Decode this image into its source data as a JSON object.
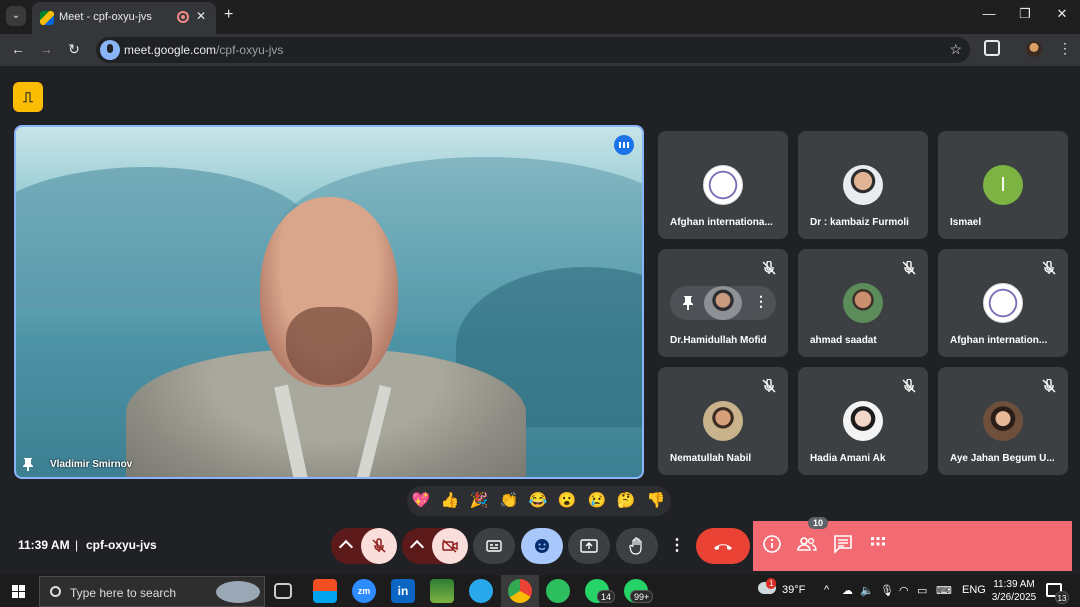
{
  "browser": {
    "tab_title": "Meet - cpf-oxyu-jvs",
    "new_tab_label": "+",
    "url_host": "meet.google.com",
    "url_path": "/cpf-oxyu-jvs",
    "window_controls": [
      "—",
      "❐",
      "✕"
    ]
  },
  "meet": {
    "main_speaker_name": "Vladimir Smirnov",
    "participants": [
      {
        "name": "Afghan internationa...",
        "avatar": "seal-logo",
        "muted": false
      },
      {
        "name": "Dr : kambaiz Furmoli",
        "avatar": "photo",
        "muted": false
      },
      {
        "name": "Ismael",
        "avatar": "letter",
        "letter": "I",
        "muted": false
      },
      {
        "name": "Dr.Hamidullah Mofid",
        "avatar": "photo",
        "muted": true
      },
      {
        "name": "ahmad saadat",
        "avatar": "photo",
        "muted": true
      },
      {
        "name": "Afghan internation...",
        "avatar": "seal-logo",
        "muted": true
      },
      {
        "name": "Nematullah Nabil",
        "avatar": "photo",
        "muted": true
      },
      {
        "name": "Hadia Amani Ak",
        "avatar": "photo",
        "muted": true
      },
      {
        "name": "Aye Jahan Begum U...",
        "avatar": "photo",
        "muted": true
      }
    ],
    "reactions": [
      "💖",
      "👍",
      "🎉",
      "👏",
      "😂",
      "😮",
      "😢",
      "🤔",
      "👎"
    ],
    "time": "11:39 AM",
    "separator": "|",
    "meeting_code": "cpf-oxyu-jvs",
    "people_count": "10",
    "colors": {
      "accent": "#8ab4f8",
      "end_call": "#ea4335",
      "panel_highlight": "#f26b73",
      "muted_red": "#f9dedc"
    }
  },
  "taskbar": {
    "search_placeholder": "Type here to search",
    "badges": {
      "whatsapp": "14",
      "whatsapp2": "99+"
    },
    "weather": "39°F",
    "language": "ENG",
    "clock_time": "11:39 AM",
    "clock_date": "3/26/2025",
    "weather_alert": "1",
    "notifications": "13",
    "zoom_label": "zm",
    "linkedin_label": "in"
  }
}
